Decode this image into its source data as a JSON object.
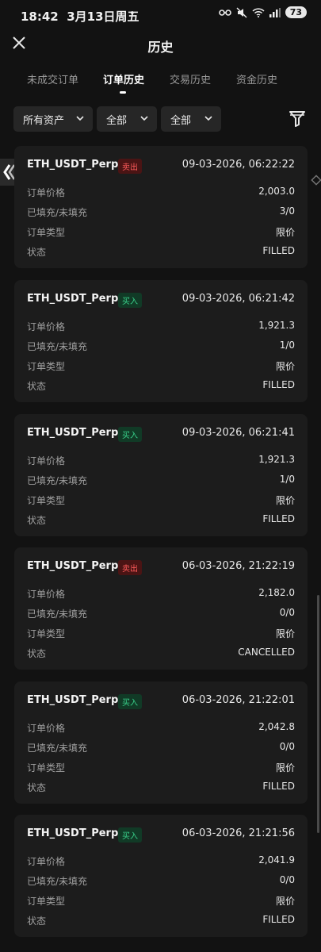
{
  "status_bar": {
    "time": "18:42",
    "date": "3月13日周五",
    "dot": "•",
    "battery": "73"
  },
  "header": {
    "title": "历史"
  },
  "tabs": [
    {
      "label": "未成交订单",
      "active": false
    },
    {
      "label": "订单历史",
      "active": true
    },
    {
      "label": "交易历史",
      "active": false
    },
    {
      "label": "资金历史",
      "active": false
    }
  ],
  "filters": {
    "asset": "所有资产",
    "type_all_1": "全部",
    "type_all_2": "全部"
  },
  "row_labels": {
    "price": "订单价格",
    "filled": "已填充/未填充",
    "type": "订单类型",
    "status": "状态"
  },
  "orders": [
    {
      "pair": "ETH_USDT_Perp",
      "side": "卖出",
      "side_kind": "sell",
      "time": "09-03-2026, 06:22:22",
      "price": "2,003.0",
      "filled": "3/0",
      "type": "限价",
      "status": "FILLED"
    },
    {
      "pair": "ETH_USDT_Perp",
      "side": "买入",
      "side_kind": "buy",
      "time": "09-03-2026, 06:21:42",
      "price": "1,921.3",
      "filled": "1/0",
      "type": "限价",
      "status": "FILLED"
    },
    {
      "pair": "ETH_USDT_Perp",
      "side": "买入",
      "side_kind": "buy",
      "time": "09-03-2026, 06:21:41",
      "price": "1,921.3",
      "filled": "1/0",
      "type": "限价",
      "status": "FILLED"
    },
    {
      "pair": "ETH_USDT_Perp",
      "side": "卖出",
      "side_kind": "sell",
      "time": "06-03-2026, 21:22:19",
      "price": "2,182.0",
      "filled": "0/0",
      "type": "限价",
      "status": "CANCELLED"
    },
    {
      "pair": "ETH_USDT_Perp",
      "side": "买入",
      "side_kind": "buy",
      "time": "06-03-2026, 21:22:01",
      "price": "2,042.8",
      "filled": "0/0",
      "type": "限价",
      "status": "FILLED"
    },
    {
      "pair": "ETH_USDT_Perp",
      "side": "买入",
      "side_kind": "buy",
      "time": "06-03-2026, 21:21:56",
      "price": "2,041.9",
      "filled": "0/0",
      "type": "限价",
      "status": "FILLED"
    }
  ],
  "icons": {
    "close": "close-icon",
    "filter": "filter-icon",
    "chevron": "chevron-down-icon",
    "side_handle": "side-arrow-icon",
    "side_right": "diamond-icon",
    "status": [
      "key-icon",
      "mute-icon",
      "wifi-icon",
      "signal-icon"
    ]
  },
  "colors": {
    "background": "#121212",
    "card": "#1c1c1c",
    "sell": "#ff5b5b",
    "buy": "#39d08a"
  }
}
